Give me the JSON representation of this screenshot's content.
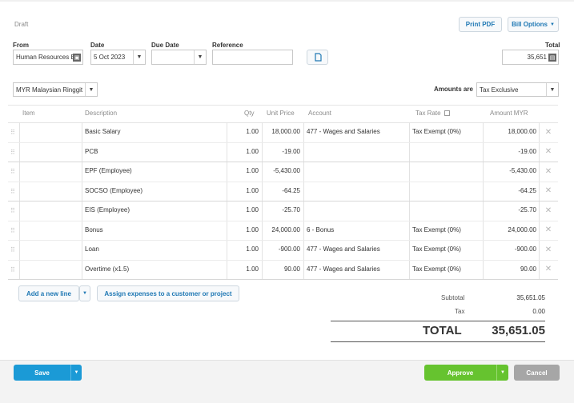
{
  "status": "Draft",
  "actions": {
    "print_pdf": "Print PDF",
    "bill_options": "Bill Options"
  },
  "header": {
    "from_label": "From",
    "from_value": "Human Resources B",
    "date_label": "Date",
    "date_value": "5 Oct 2023",
    "due_label": "Due Date",
    "due_value": "",
    "reference_label": "Reference",
    "reference_value": "",
    "total_label": "Total",
    "total_value": "35,651"
  },
  "currency": "MYR Malaysian Ringgit",
  "amounts_are": {
    "label": "Amounts are",
    "value": "Tax Exclusive"
  },
  "table": {
    "headers": [
      "Item",
      "Description",
      "Qty",
      "Unit Price",
      "Account",
      "Tax Rate",
      "Amount MYR"
    ],
    "rows": [
      {
        "item": "",
        "description": "Basic Salary",
        "qty": "1.00",
        "unit_price": "18,000.00",
        "account": "477 - Wages and Salaries",
        "tax_rate": "Tax Exempt (0%)",
        "amount": "18,000.00"
      },
      {
        "item": "",
        "description": "PCB",
        "qty": "1.00",
        "unit_price": "-19.00",
        "account": "",
        "tax_rate": "",
        "amount": "-19.00"
      },
      {
        "item": "",
        "description": "EPF (Employee)",
        "qty": "1.00",
        "unit_price": "-5,430.00",
        "account": "",
        "tax_rate": "",
        "amount": "-5,430.00"
      },
      {
        "item": "",
        "description": "SOCSO (Employee)",
        "qty": "1.00",
        "unit_price": "-64.25",
        "account": "",
        "tax_rate": "",
        "amount": "-64.25"
      },
      {
        "item": "",
        "description": "EIS (Employee)",
        "qty": "1.00",
        "unit_price": "-25.70",
        "account": "",
        "tax_rate": "",
        "amount": "-25.70"
      },
      {
        "item": "",
        "description": "Bonus",
        "qty": "1.00",
        "unit_price": "24,000.00",
        "account": "6 - Bonus",
        "tax_rate": "Tax Exempt (0%)",
        "amount": "24,000.00"
      },
      {
        "item": "",
        "description": "Loan",
        "qty": "1.00",
        "unit_price": "-900.00",
        "account": "477 - Wages and Salaries",
        "tax_rate": "Tax Exempt (0%)",
        "amount": "-900.00"
      },
      {
        "item": "",
        "description": "Overtime (x1.5)",
        "qty": "1.00",
        "unit_price": "90.00",
        "account": "477 - Wages and Salaries",
        "tax_rate": "Tax Exempt (0%)",
        "amount": "90.00"
      }
    ]
  },
  "line_actions": {
    "add_line": "Add a new line",
    "assign_expenses": "Assign expenses to a customer or project"
  },
  "summary": {
    "subtotal_label": "Subtotal",
    "subtotal_value": "35,651.05",
    "tax_label": "Tax",
    "tax_value": "0.00",
    "total_label": "TOTAL",
    "total_value": "35,651.05"
  },
  "footer": {
    "save": "Save",
    "approve": "Approve",
    "cancel": "Cancel"
  },
  "colors": {
    "link_blue": "#1f78b4",
    "save_blue": "#1b9ad6",
    "approve_green": "#66c32f",
    "cancel_gray": "#a6a6a6"
  }
}
